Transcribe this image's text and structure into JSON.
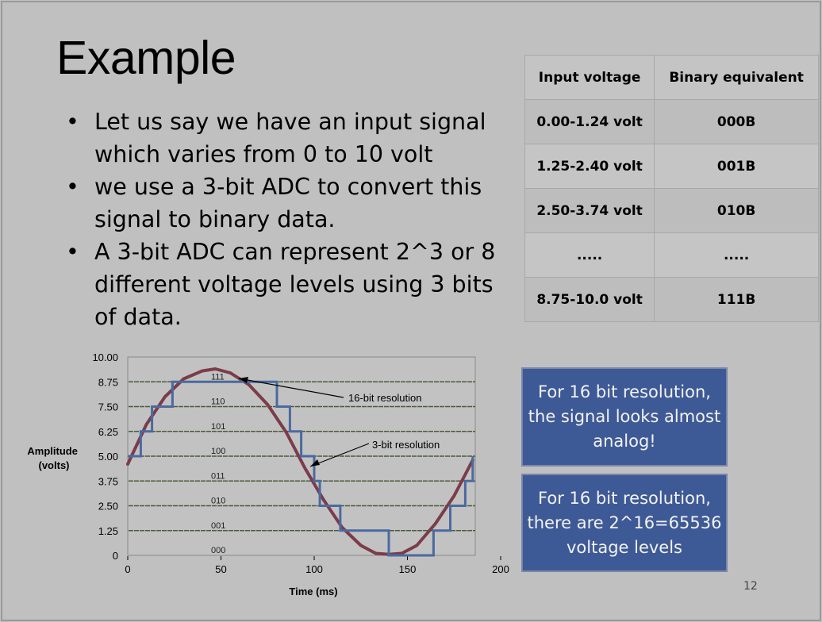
{
  "slide": {
    "title": "Example",
    "bullets": [
      "Let us say we have an input signal which varies from 0 to 10 volt",
      "we use a 3-bit ADC to convert this signal to binary data.",
      "A 3-bit ADC can represent 2^3 or 8 different voltage levels using 3 bits of data."
    ],
    "page_number": "12"
  },
  "table": {
    "headers": [
      "Input voltage",
      "Binary equivalent"
    ],
    "rows": [
      [
        "0.00-1.24 volt",
        "000B"
      ],
      [
        "1.25-2.40 volt",
        "001B"
      ],
      [
        "2.50-3.74 volt",
        "010B"
      ],
      [
        ".....",
        "....."
      ],
      [
        "8.75-10.0 volt",
        "111B"
      ]
    ]
  },
  "callouts": [
    "For 16 bit resolution, the signal looks almost analog!",
    "For 16 bit resolution, there are 2^16=65536 voltage levels"
  ],
  "chart_data": {
    "type": "line",
    "xlabel": "Time (ms)",
    "ylabel": "Amplitude (volts)",
    "xlim": [
      0,
      200
    ],
    "ylim": [
      0,
      10
    ],
    "x_ticks": [
      "0",
      "50",
      "100",
      "150",
      "200"
    ],
    "y_ticks": [
      "0",
      "1.25",
      "2.50",
      "3.75",
      "5.00",
      "6.25",
      "7.50",
      "8.75",
      "10.00"
    ],
    "level_codes": [
      "000",
      "001",
      "010",
      "011",
      "100",
      "101",
      "110",
      "111"
    ],
    "colors": {
      "analog": "#7b3c4a",
      "quantized": "#4a6aa0",
      "gridline": "#4a5a3a"
    },
    "series": [
      {
        "name": "16-bit resolution",
        "x": [
          0,
          10,
          20,
          30,
          40,
          47,
          55,
          65,
          75,
          85,
          95,
          105,
          115,
          125,
          133,
          140,
          147,
          155,
          165,
          175,
          185
        ],
        "y": [
          4.6,
          6.6,
          8.0,
          8.9,
          9.3,
          9.4,
          9.2,
          8.6,
          7.6,
          6.2,
          4.4,
          2.8,
          1.4,
          0.5,
          0.1,
          0.05,
          0.1,
          0.5,
          1.6,
          3.0,
          4.8
        ]
      },
      {
        "name": "3-bit resolution",
        "x": [
          0,
          7,
          13,
          24,
          80,
          87,
          93,
          100,
          103,
          114,
          128,
          140,
          164,
          173,
          181,
          185
        ],
        "y": [
          5.0,
          6.25,
          7.5,
          8.75,
          7.5,
          6.25,
          5.0,
          3.75,
          2.5,
          1.25,
          1.25,
          0,
          1.25,
          2.5,
          3.75,
          5.0
        ]
      }
    ],
    "annotations": [
      "16-bit resolution",
      "3-bit resolution"
    ]
  }
}
